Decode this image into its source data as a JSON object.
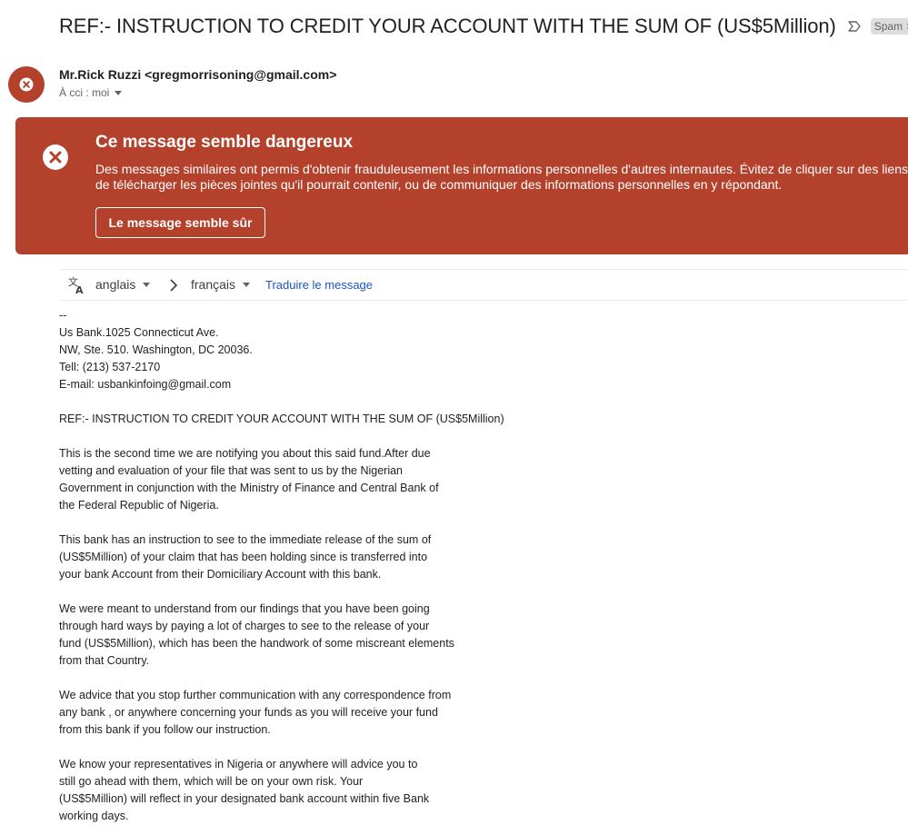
{
  "subject": "REF:- INSTRUCTION TO CREDIT YOUR ACCOUNT WITH THE SUM OF (US$5Million)",
  "label": {
    "text": "Spam",
    "remove": "×"
  },
  "sender": {
    "display": "Mr.Rick Ruzzi <gregmorrisoning@gmail.com>",
    "recipients": "À cci : moi"
  },
  "warning": {
    "title": "Ce message semble dangereux",
    "text": "Des messages similaires ont permis d'obtenir frauduleusement les informations personnelles d'autres internautes. Évitez de cliquer sur des liens, de télécharger les pièces jointes qu'il pourrait contenir, ou de communiquer des informations personnelles en y répondant.",
    "button": "Le message semble sûr"
  },
  "translate": {
    "from": "anglais",
    "to": "français",
    "link": "Traduire le message"
  },
  "body": {
    "p0": [
      "--",
      "Us Bank.1025 Connecticut Ave.",
      "NW, Ste. 510. Washington, DC 20036.",
      "Tell: (213) 537-2170",
      "E-mail: usbankinfoing@gmail.com"
    ],
    "p1": [
      "REF:- INSTRUCTION TO CREDIT YOUR ACCOUNT WITH THE SUM OF (US$5Million)"
    ],
    "p2": [
      "This is the second time we are notifying you about this said fund.After due",
      "vetting and evaluation of your file that was sent to us by the Nigerian",
      "Government in conjunction with the Ministry of Finance and Central Bank of",
      "the Federal Republic of Nigeria."
    ],
    "p3": [
      "This bank has an instruction to see to the immediate release of the sum of",
      "(US$5Million) of your claim that has been holding since is transferred into",
      "your bank Account from their Domiciliary Account with this bank."
    ],
    "p4": [
      "We were meant to understand from our findings that you have been going",
      "through hard ways by paying a lot of charges to see to the release of your",
      "fund (US$5Million), which has been the handwork of some miscreant elements",
      "from that Country."
    ],
    "p5": [
      "We advice that you stop further communication with any correspondence from",
      "any bank , or anywhere concerning your funds as you will receive your fund",
      "from this bank if you follow our instruction."
    ],
    "p6": [
      "We know your representatives in Nigeria or anywhere will advice you to",
      "still go ahead with them, which will be on your own risk. Your",
      "(US$5Million) will reflect in your designated bank account within five Bank",
      "working days."
    ]
  },
  "icons": {
    "important": "important-marker-icon",
    "avatar": "error-x-icon",
    "danger": "warning-x-icon",
    "translate": "translate-icon",
    "arrow": "chevron-right-icon"
  },
  "colors": {
    "danger": "#b3412c",
    "link": "#1a56c4",
    "chip": "#dddddd"
  }
}
